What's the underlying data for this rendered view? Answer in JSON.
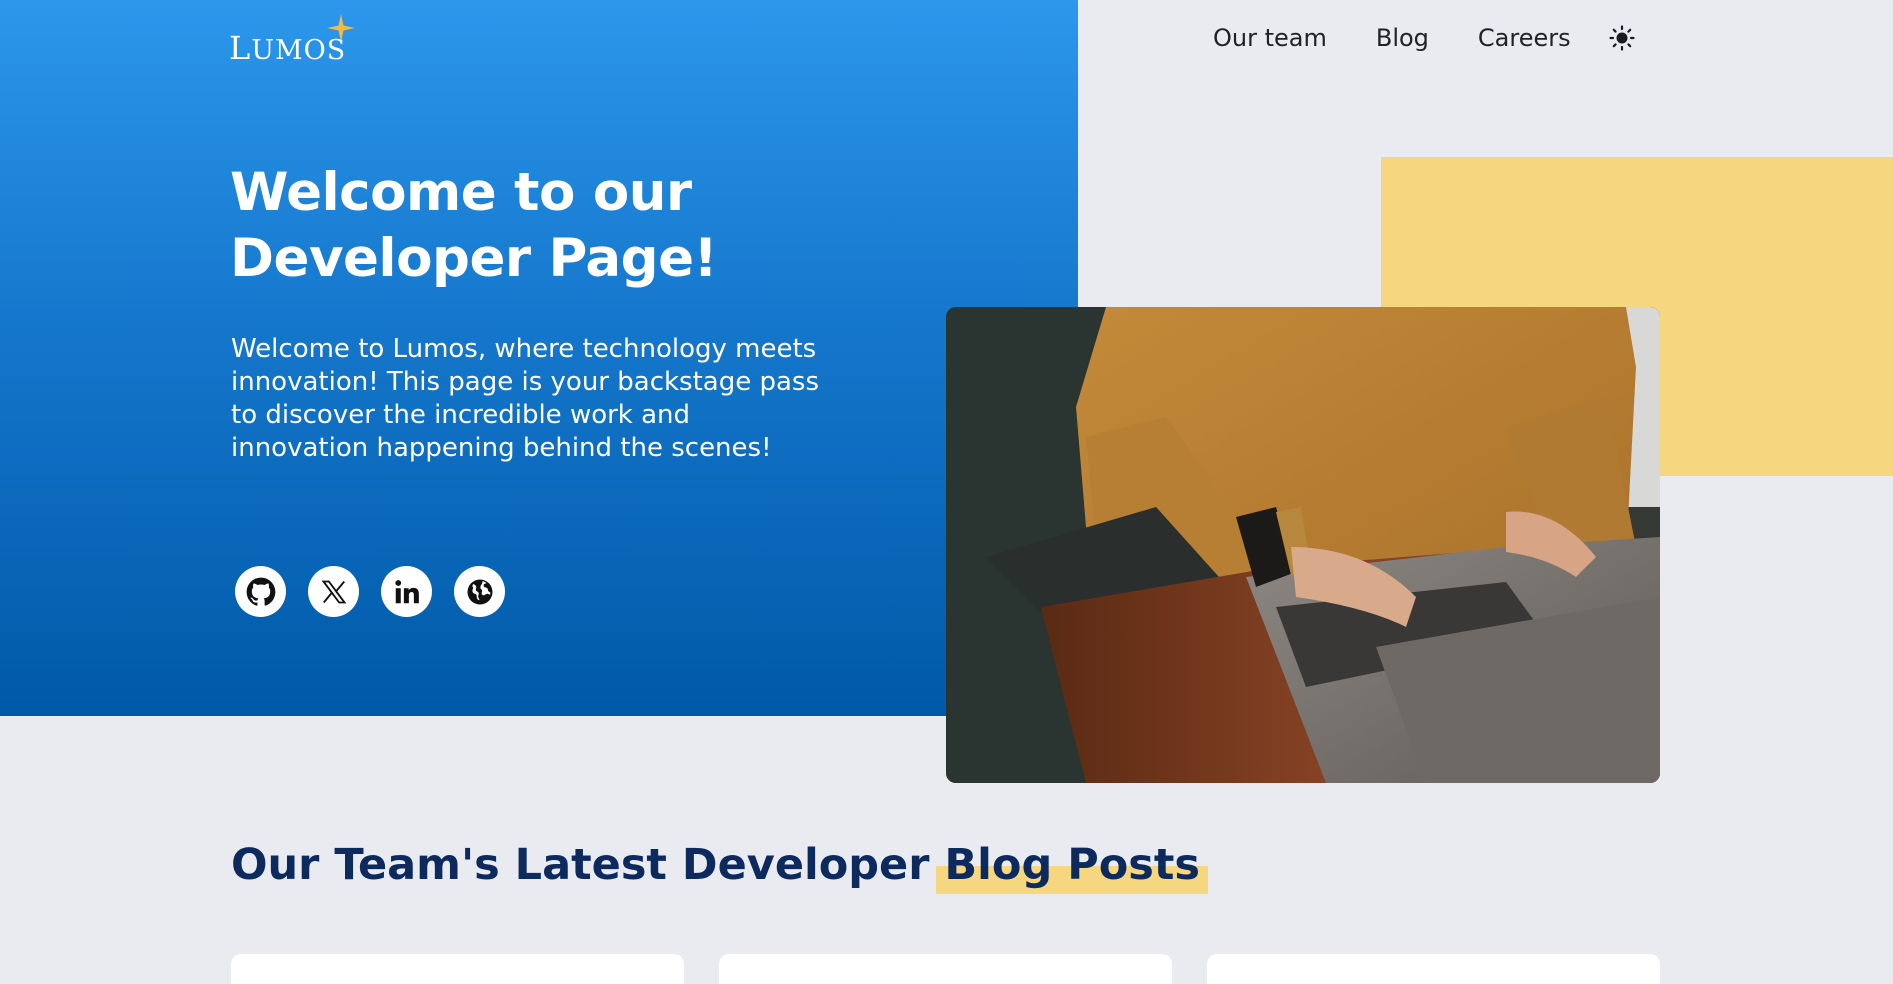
{
  "brand": {
    "logo_text": "Lumos"
  },
  "nav": {
    "items": [
      "Our team",
      "Blog",
      "Careers"
    ]
  },
  "hero": {
    "title": "Welcome to our Developer Page!",
    "description": "Welcome to Lumos, where technology meets innovation! This page is your backstage pass to discover the incredible work and innovation happening behind the scenes!"
  },
  "socials": [
    {
      "icon": "github-icon"
    },
    {
      "icon": "x-icon"
    },
    {
      "icon": "linkedin-icon"
    },
    {
      "icon": "globe-icon"
    }
  ],
  "section": {
    "title_prefix": "Our Team's Latest Developer ",
    "title_highlight": "Blog Posts"
  },
  "colors": {
    "hero_gradient_top": "#2c97ec",
    "hero_gradient_bottom": "#0059a8",
    "accent_yellow": "#f6d77f",
    "page_background": "#e9ebf0",
    "heading_navy": "#0d2a5e"
  }
}
